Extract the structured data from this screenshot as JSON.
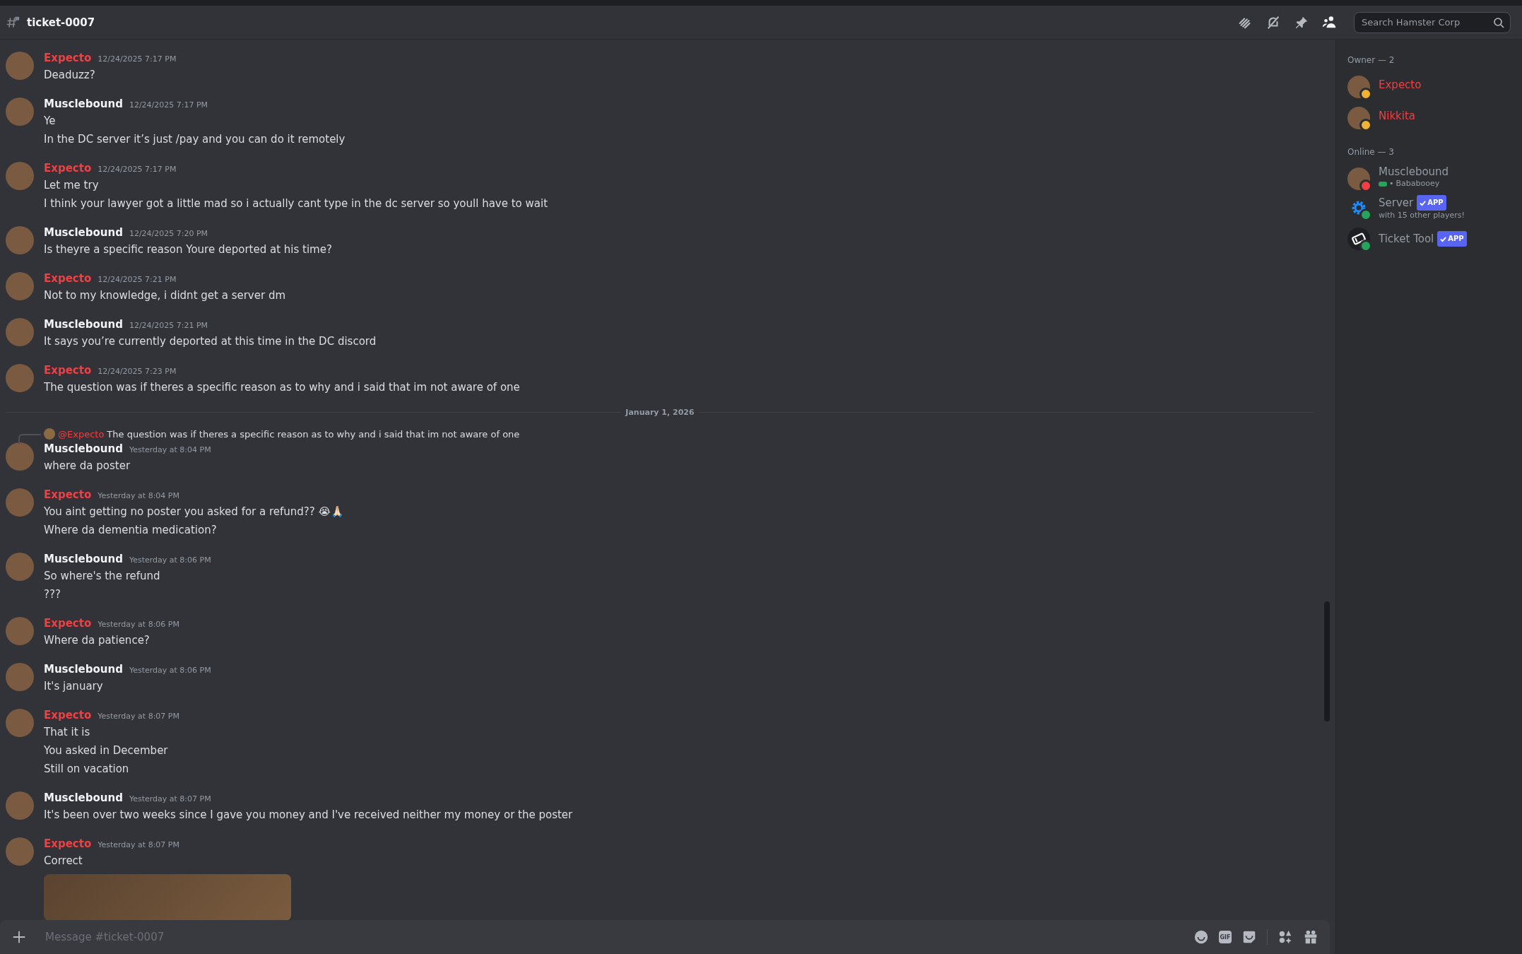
{
  "channel": {
    "name": "ticket-0007"
  },
  "search": {
    "placeholder": "Search Hamster Corp"
  },
  "messages": [
    {
      "kind": "message",
      "author": "Expecto",
      "color": "#f23f43",
      "time": "12/24/2025 7:17 PM",
      "lines": [
        "Deaduzz?"
      ]
    },
    {
      "kind": "message",
      "author": "Musclebound",
      "color": "#f2f3f5",
      "time": "12/24/2025 7:17 PM",
      "lines": [
        "Ye",
        "In the DC server it’s just /pay and you can do it remotely"
      ]
    },
    {
      "kind": "message",
      "author": "Expecto",
      "color": "#f23f43",
      "time": "12/24/2025 7:17 PM",
      "lines": [
        "Let me try",
        "I think your lawyer got a little mad so i actually cant type in the dc server so youll have to wait"
      ]
    },
    {
      "kind": "message",
      "author": "Musclebound",
      "color": "#f2f3f5",
      "time": "12/24/2025 7:20 PM",
      "lines": [
        "Is theyre a specific reason Youre deported at his time?"
      ]
    },
    {
      "kind": "message",
      "author": "Expecto",
      "color": "#f23f43",
      "time": "12/24/2025 7:21 PM",
      "lines": [
        "Not to my knowledge, i didnt get a server dm"
      ]
    },
    {
      "kind": "message",
      "author": "Musclebound",
      "color": "#f2f3f5",
      "time": "12/24/2025 7:21 PM",
      "lines": [
        "It says you’re currently deported at this time in the DC discord"
      ]
    },
    {
      "kind": "message",
      "author": "Expecto",
      "color": "#f23f43",
      "time": "12/24/2025 7:23 PM",
      "lines": [
        "The question was if theres a specific reason as to why and i said that im not aware of one"
      ]
    },
    {
      "kind": "divider",
      "label": "January 1, 2026"
    },
    {
      "kind": "message",
      "author": "Musclebound",
      "color": "#f2f3f5",
      "time": "Yesterday at 8:04 PM",
      "reply": {
        "mention": "@Expecto",
        "text": "The question was if theres a specific reason as to why and i said that im not aware of one"
      },
      "lines": [
        "where da poster"
      ]
    },
    {
      "kind": "message",
      "author": "Expecto",
      "color": "#f23f43",
      "time": "Yesterday at 8:04 PM",
      "lines": [
        "You aint getting no poster you asked for a refund?? 😭🙏🏻",
        "Where da dementia medication?"
      ]
    },
    {
      "kind": "message",
      "author": "Musclebound",
      "color": "#f2f3f5",
      "time": "Yesterday at 8:06 PM",
      "lines": [
        "So where's the refund",
        "???"
      ]
    },
    {
      "kind": "message",
      "author": "Expecto",
      "color": "#f23f43",
      "time": "Yesterday at 8:06 PM",
      "lines": [
        "Where da patience?"
      ]
    },
    {
      "kind": "message",
      "author": "Musclebound",
      "color": "#f2f3f5",
      "time": "Yesterday at 8:06 PM",
      "lines": [
        "It's january"
      ]
    },
    {
      "kind": "message",
      "author": "Expecto",
      "color": "#f23f43",
      "time": "Yesterday at 8:07 PM",
      "lines": [
        "That it is",
        "You asked in December",
        "Still on vacation"
      ]
    },
    {
      "kind": "message",
      "author": "Musclebound",
      "color": "#f2f3f5",
      "time": "Yesterday at 8:07 PM",
      "lines": [
        "It's been over two weeks since I gave you money and I've received neither my money or the poster"
      ]
    },
    {
      "kind": "message",
      "author": "Expecto",
      "color": "#f23f43",
      "time": "Yesterday at 8:07 PM",
      "lines": [
        "Correct"
      ],
      "attachment": true
    }
  ],
  "composer": {
    "placeholder": "Message #ticket-0007",
    "tools": [
      {
        "kind": "emoji"
      },
      {
        "kind": "gif",
        "label": "GIF"
      },
      {
        "kind": "sticker"
      },
      {
        "kind": "apps"
      },
      {
        "kind": "gift"
      }
    ]
  },
  "member_groups": [
    {
      "title": "Owner — 2",
      "members": [
        {
          "kind": "photo",
          "name": "Expecto",
          "color": "#f23f43",
          "status": {
            "color": "#f0b232"
          }
        },
        {
          "kind": "photo",
          "name": "Nikkita",
          "color": "#f23f43",
          "status": {
            "color": "#f0b232"
          }
        }
      ]
    },
    {
      "title": "Online — 3",
      "members": [
        {
          "kind": "photo",
          "name": "Musclebound",
          "color": "#949ba4",
          "status": {
            "color": "#f23f43"
          },
          "game": true,
          "separator": "•",
          "activity": "Bababooey"
        },
        {
          "kind": "gear",
          "name": "Server",
          "color": "#949ba4",
          "status": {
            "color": "#23a55a"
          },
          "app": "APP",
          "activity": "with 15 other players!"
        },
        {
          "kind": "ticket",
          "name": "Ticket Tool",
          "color": "#949ba4",
          "status": {
            "color": "#23a55a"
          },
          "app": "APP"
        }
      ]
    }
  ]
}
